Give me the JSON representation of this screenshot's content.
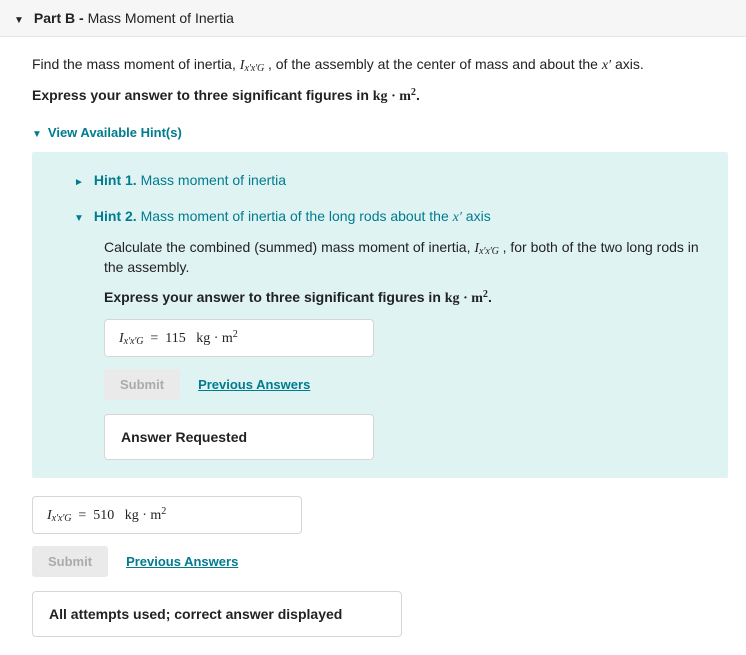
{
  "part": {
    "prefix": "Part B -",
    "title": "Mass Moment of Inertia"
  },
  "prompt": {
    "pre": "Find the mass moment of inertia, ",
    "symbol_var": "I",
    "symbol_sub": "x′x′G",
    "mid": " , of the assembly at the center of mass and about the ",
    "axis_var": "x′",
    "post": " axis."
  },
  "direction_prefix": "Express your answer to three significant figures in ",
  "unit_html": "kg · m²",
  "hints_toggle": "View Available Hint(s)",
  "hint1": {
    "label": "Hint 1.",
    "title": "Mass moment of inertia"
  },
  "hint2": {
    "label": "Hint 2.",
    "title": "Mass moment of inertia of the long rods about the x′ axis",
    "desc_pre": "Calculate the combined (summed) mass moment of inertia, ",
    "desc_post": " , for both of the two long rods in the assembly.",
    "direction_prefix": "Express your answer to three significant figures in ",
    "answer_value": "115",
    "submit": "Submit",
    "prev": "Previous Answers",
    "status": "Answer Requested"
  },
  "main_answer": {
    "value": "510",
    "submit": "Submit",
    "prev": "Previous Answers",
    "status": "All attempts used; correct answer displayed"
  }
}
